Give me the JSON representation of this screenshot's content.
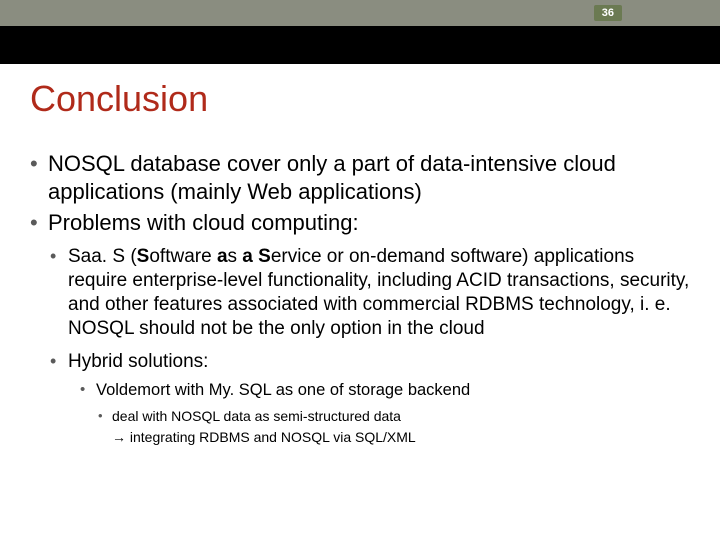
{
  "header": {
    "page_number": "36"
  },
  "title": "Conclusion",
  "bullets": {
    "b1": "NOSQL database cover only a part of data-intensive cloud applications (mainly Web applications)",
    "b2": "Problems with cloud computing:",
    "b2_1_prefix": "Saa. S (",
    "b2_1_bold1": "S",
    "b2_1_mid1": "oftware ",
    "b2_1_bold2": "a",
    "b2_1_mid2": "s ",
    "b2_1_bold3": "a",
    "b2_1_mid3": " ",
    "b2_1_bold4": "S",
    "b2_1_tail": "ervice or on-demand software) applications require enterprise-level functionality, including ACID transactions, security, and other features associated with commercial RDBMS technology, i. e. NOSQL should not be the only option in the cloud",
    "b2_2": "Hybrid solutions:",
    "b2_2_1": "Voldemort with My. SQL as one of storage backend",
    "b2_2_2": "deal with NOSQL data as semi-structured data",
    "b2_2_2_sub_arrow": "Þ",
    "b2_2_2_sub": " integrating RDBMS and NOSQL via SQL/XML"
  }
}
